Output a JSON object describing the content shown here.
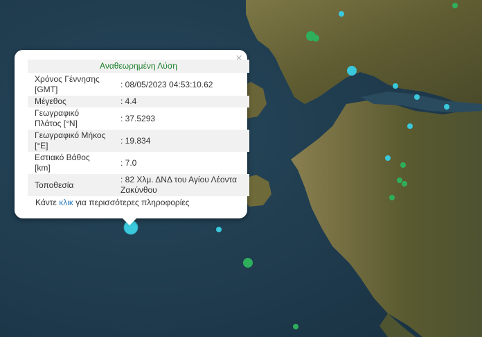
{
  "popup": {
    "title": "Αναθεωρημένη Λύση",
    "close_glyph": "×",
    "rows": [
      {
        "label": "Χρόνος Γέννησης [GMT]",
        "value": ": 08/05/2023 04:53:10.62"
      },
      {
        "label": "Μέγεθος",
        "value": ": 4.4"
      },
      {
        "label": "Γεωγραφικό Πλάτος [°N]",
        "value": ": 37.5293"
      },
      {
        "label": "Γεωγραφικό Μήκος [°E]",
        "value": ": 19.834"
      },
      {
        "label": "Εστιακό Βάθος [km]",
        "value": ": 7.0"
      },
      {
        "label": "Τοποθεσία",
        "value": ": 82 Χλμ. ΔΝΔ του Αγίου Λέοντα Ζακύνθου"
      }
    ],
    "more_prefix": "Κάντε",
    "more_link": "κλικ",
    "more_suffix": "για περισσότερες πληροφορίες"
  },
  "colors": {
    "sea": "#223f52",
    "land": "#6e6a3c",
    "marker_cyan": "#3ac8dc",
    "marker_green": "#2fae5c",
    "title_green": "#1a7f2a",
    "link_blue": "#2a7ab8"
  }
}
